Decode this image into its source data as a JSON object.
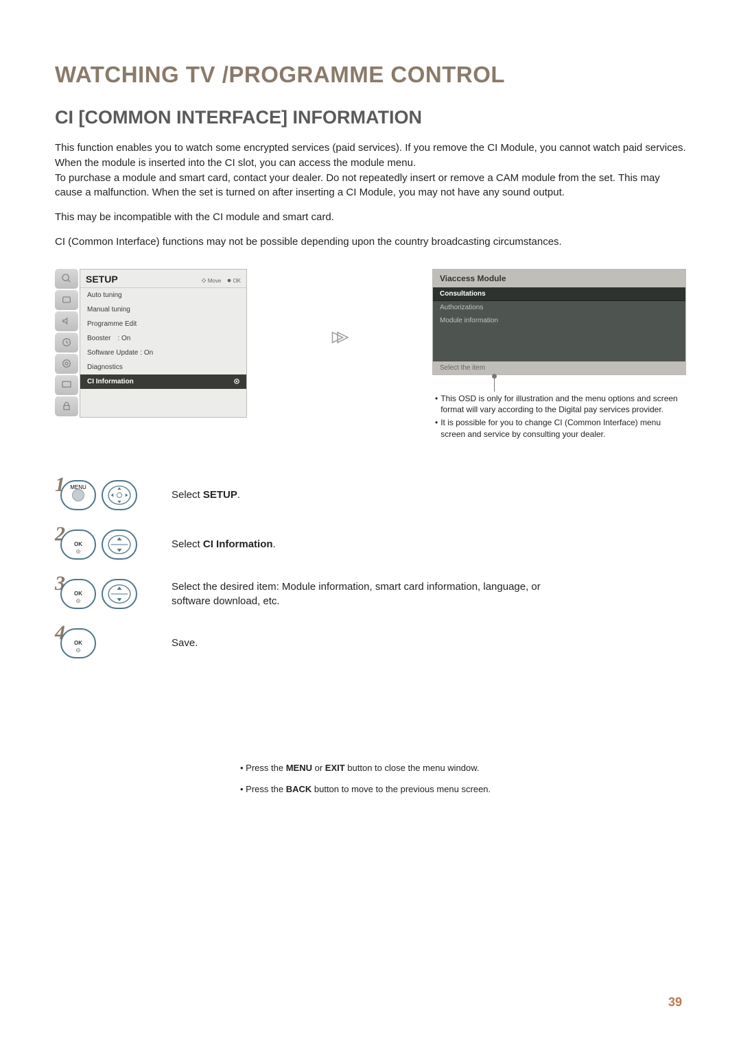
{
  "title": "WATCHING TV /PROGRAMME CONTROL",
  "section_title": "CI [COMMON INTERFACE] INFORMATION",
  "paragraphs": [
    "This function enables you to watch some encrypted services (paid services). If you remove the CI Module, you cannot watch paid services.\nWhen the module is inserted into the CI slot, you can access the module menu.\nTo purchase a module and smart card, contact your dealer. Do not repeatedly insert or remove a CAM module from the set. This may cause a malfunction. When the set is turned on after inserting a CI Module, you may not have any sound output.",
    "This may be incompatible with the CI module and smart card.",
    "CI (Common Interface) functions may not be possible depending upon the country broadcasting circumstances."
  ],
  "setup_menu": {
    "header": "SETUP",
    "hint_move": "Move",
    "hint_ok": "OK",
    "items": [
      {
        "label": "Auto tuning"
      },
      {
        "label": "Manual tuning"
      },
      {
        "label": "Programme Edit"
      },
      {
        "label": "Booster",
        "value": ": On"
      },
      {
        "label": "Software Update : On"
      },
      {
        "label": "Diagnostics"
      },
      {
        "label": "CI Information",
        "selected": true
      }
    ]
  },
  "module_panel": {
    "title": "Viaccess Module",
    "items": [
      "Consultations",
      "Authorizations",
      "Module information"
    ],
    "footer": "Select the item",
    "notes": [
      "This OSD is only for illustration and the menu options and screen format will vary according to the Digital pay services provider.",
      "It is possible for you to change CI (Common Interface) menu screen and service by consulting your dealer."
    ]
  },
  "steps": [
    {
      "num": "1",
      "btns": [
        "menu",
        "nav4"
      ],
      "text_before": "Select ",
      "bold": "SETUP",
      "text_after": "."
    },
    {
      "num": "2",
      "btns": [
        "ok",
        "nav2"
      ],
      "text_before": "Select ",
      "bold": "CI Information",
      "text_after": "."
    },
    {
      "num": "3",
      "btns": [
        "ok",
        "nav2"
      ],
      "text_before": "Select the desired item: Module information, smart card information, language, or software download, etc.",
      "bold": "",
      "text_after": ""
    },
    {
      "num": "4",
      "btns": [
        "ok"
      ],
      "text_before": "Save.",
      "bold": "",
      "text_after": ""
    }
  ],
  "footer_notes": {
    "n1_pre": "• Press the ",
    "n1_b1": "MENU",
    "n1_mid": " or ",
    "n1_b2": "EXIT",
    "n1_post": " button to close the menu window.",
    "n2_pre": "• Press the ",
    "n2_b": "BACK",
    "n2_post": " button to move to the previous menu screen."
  },
  "page_number": "39",
  "btn_labels": {
    "menu": "MENU",
    "ok": "OK"
  }
}
